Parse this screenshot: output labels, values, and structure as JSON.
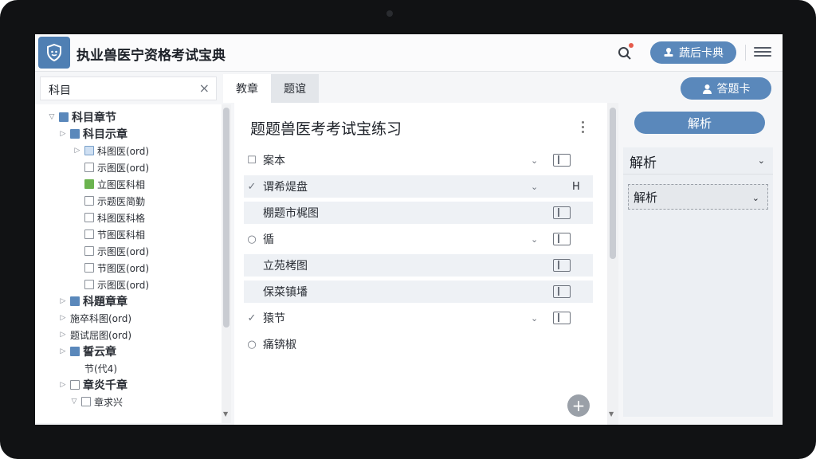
{
  "header": {
    "app_title": "执业兽医宁资格考试宝典",
    "action_label": "蔬后卡典"
  },
  "subject": {
    "label": "科目",
    "close_glyph": "×"
  },
  "tree": [
    {
      "label": "科目章节",
      "bold": true,
      "caret": "▽",
      "box": "blue"
    },
    {
      "label": "科目示章",
      "bold": true,
      "caret": "▷",
      "box": "blue"
    },
    {
      "label": "科图医(ord)",
      "caret": "▷",
      "box": "light"
    },
    {
      "label": "示图医(ord)",
      "caret": "",
      "box": "plain"
    },
    {
      "label": "立图医科相",
      "caret": "",
      "box": "green"
    },
    {
      "label": "示题医简勤",
      "caret": "",
      "box": "plain"
    },
    {
      "label": "科图医科格",
      "caret": "",
      "box": "plain"
    },
    {
      "label": "节图医科相",
      "caret": "",
      "box": "plain"
    },
    {
      "label": "示图医(ord)",
      "caret": "",
      "box": "plain"
    },
    {
      "label": "节图医(ord)",
      "caret": "",
      "box": "plain"
    },
    {
      "label": "示图医(ord)",
      "caret": "",
      "box": "plain"
    },
    {
      "label": "科題章章",
      "bold": true,
      "caret": "▷",
      "box": "blue"
    },
    {
      "label": "施卒科图(ord)",
      "caret": "▷",
      "box": "none"
    },
    {
      "label": "题试屈图(ord)",
      "caret": "▷",
      "box": "none"
    },
    {
      "label": "誓云章",
      "bold": true,
      "caret": "▷",
      "box": "blue"
    },
    {
      "label": "节(代4)",
      "caret": "",
      "box": "none"
    },
    {
      "label": "章炎千章",
      "bold": true,
      "caret": "▷",
      "box": "plain"
    },
    {
      "label": "章求兴",
      "caret": "▽",
      "box": "plain"
    }
  ],
  "tabs": [
    {
      "label": "教章",
      "active": true
    },
    {
      "label": "题谊",
      "active": false
    }
  ],
  "answer_card": {
    "label": "答题卡"
  },
  "center": {
    "title": "题题兽医考考试宝练习",
    "rows": [
      {
        "mark": "☐",
        "label": "案本",
        "shaded": false,
        "chevron": "⌄",
        "toggle": true,
        "extra": ""
      },
      {
        "mark": "✓",
        "label": "谓希煶盘",
        "shaded": true,
        "chevron": "⌄",
        "toggle": false,
        "extra": "H"
      },
      {
        "mark": "",
        "label": "棚题市梶图",
        "shaded": true,
        "chevron": "",
        "toggle": true,
        "extra": ""
      },
      {
        "mark": "○",
        "label": "循",
        "shaded": false,
        "chevron": "⌄",
        "toggle": true,
        "extra": ""
      },
      {
        "mark": "",
        "label": "立苑栲图",
        "shaded": true,
        "chevron": "",
        "toggle": true,
        "extra": ""
      },
      {
        "mark": "",
        "label": "保菜镇墦",
        "shaded": true,
        "chevron": "",
        "toggle": true,
        "extra": ""
      },
      {
        "mark": "✓",
        "label": "猿节",
        "shaded": false,
        "chevron": "⌄",
        "toggle": true,
        "extra": ""
      },
      {
        "mark": "○",
        "label": "痛锛椒",
        "shaded": false,
        "chevron": "",
        "toggle": false,
        "extra": ""
      }
    ],
    "fab_glyph": "+"
  },
  "right": {
    "analysis_button": "解析",
    "panel_title": "解析",
    "select_value": "解析"
  }
}
